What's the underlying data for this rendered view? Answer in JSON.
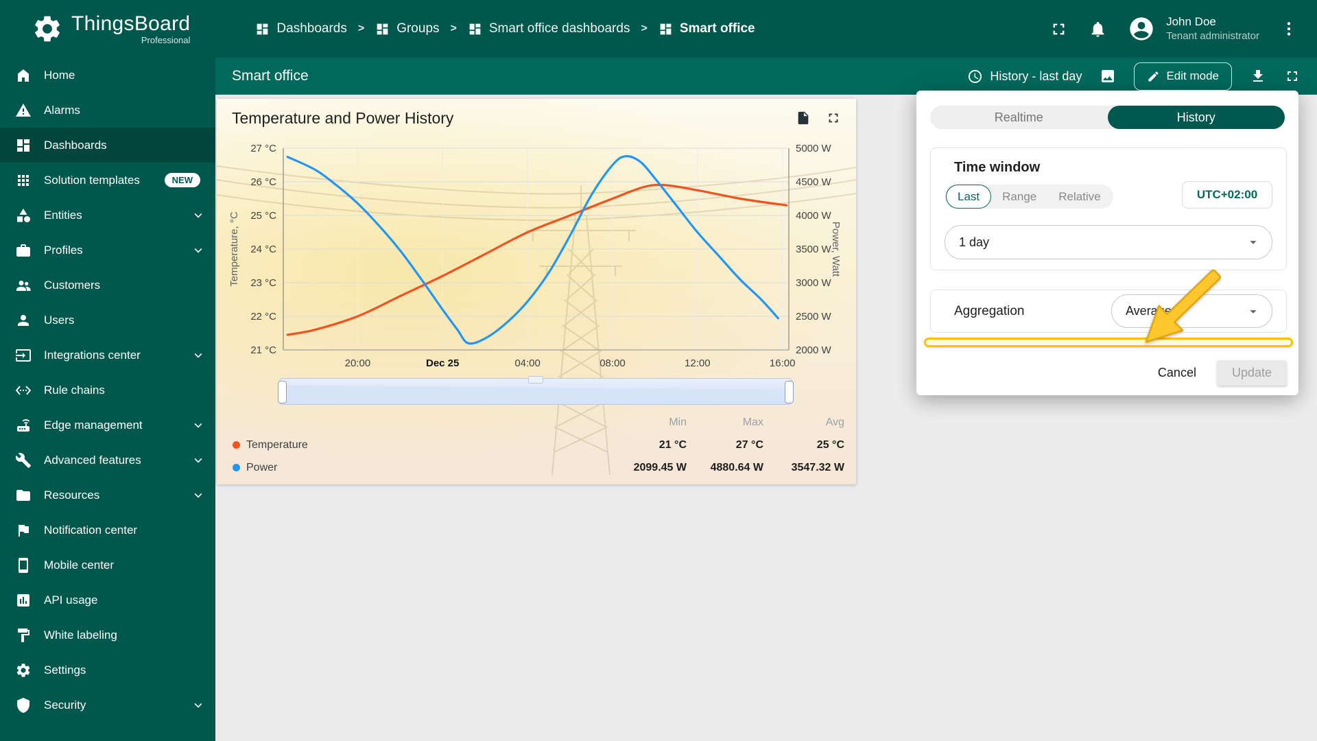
{
  "header": {
    "logo_title": "ThingsBoard",
    "logo_subtitle": "Professional",
    "separator": ">",
    "breadcrumbs": [
      {
        "label": "Dashboards"
      },
      {
        "label": "Groups"
      },
      {
        "label": "Smart office dashboards"
      },
      {
        "label": "Smart office"
      }
    ],
    "user": {
      "name": "John Doe",
      "role": "Tenant administrator"
    }
  },
  "sidebar": {
    "items": [
      {
        "label": "Home",
        "icon": "home-icon"
      },
      {
        "label": "Alarms",
        "icon": "alarm-icon"
      },
      {
        "label": "Dashboards",
        "icon": "dashboards-icon",
        "active": true
      },
      {
        "label": "Solution templates",
        "icon": "apps-icon",
        "badge": "NEW"
      },
      {
        "label": "Entities",
        "icon": "entities-icon",
        "expandable": true
      },
      {
        "label": "Profiles",
        "icon": "profiles-icon",
        "expandable": true
      },
      {
        "label": "Customers",
        "icon": "customers-icon"
      },
      {
        "label": "Users",
        "icon": "users-icon"
      },
      {
        "label": "Integrations center",
        "icon": "integrations-icon",
        "expandable": true
      },
      {
        "label": "Rule chains",
        "icon": "rule-chains-icon"
      },
      {
        "label": "Edge management",
        "icon": "edge-icon",
        "expandable": true
      },
      {
        "label": "Advanced features",
        "icon": "advanced-icon",
        "expandable": true
      },
      {
        "label": "Resources",
        "icon": "resources-icon",
        "expandable": true
      },
      {
        "label": "Notification center",
        "icon": "notification-icon"
      },
      {
        "label": "Mobile center",
        "icon": "mobile-icon"
      },
      {
        "label": "API usage",
        "icon": "api-icon"
      },
      {
        "label": "White labeling",
        "icon": "white-labeling-icon"
      },
      {
        "label": "Settings",
        "icon": "settings-icon"
      },
      {
        "label": "Security",
        "icon": "security-icon",
        "expandable": true
      }
    ]
  },
  "toolbar": {
    "title": "Smart office",
    "history_label": "History - last day",
    "edit_mode_label": "Edit mode"
  },
  "widget": {
    "title": "Temperature and Power History"
  },
  "chart_data": {
    "type": "line",
    "title": "Temperature and Power History",
    "x_ticks": [
      "20:00",
      "Dec 25",
      "04:00",
      "08:00",
      "12:00",
      "16:00"
    ],
    "x_tick_hours": [
      -4,
      0,
      4,
      8,
      12,
      16
    ],
    "x_range_hours": [
      -7.5,
      16.3
    ],
    "left_axis": {
      "label": "Temperature, °C",
      "range": [
        21,
        27
      ],
      "ticks": [
        "21 °C",
        "22 °C",
        "23 °C",
        "24 °C",
        "25 °C",
        "26 °C",
        "27 °C"
      ]
    },
    "right_axis": {
      "label": "Power, Watt",
      "range": [
        2000,
        5000
      ],
      "ticks": [
        "2000 W",
        "2500 W",
        "3000 W",
        "3500 W",
        "4000 W",
        "4500 W",
        "5000 W"
      ]
    },
    "grid": true,
    "legend_position": "bottom-left",
    "summary_headers": [
      "Min",
      "Max",
      "Avg"
    ],
    "series": [
      {
        "name": "Temperature",
        "axis": "left",
        "color": "#F4511E",
        "min": "21 °C",
        "max": "27 °C",
        "avg": "25 °C",
        "points": [
          [
            -7.3,
            21.45
          ],
          [
            -6,
            21.6
          ],
          [
            -4,
            22.0
          ],
          [
            -2,
            22.6
          ],
          [
            0,
            23.2
          ],
          [
            2,
            23.85
          ],
          [
            4,
            24.5
          ],
          [
            6,
            25.0
          ],
          [
            8,
            25.5
          ],
          [
            9.5,
            25.85
          ],
          [
            10.5,
            25.9
          ],
          [
            12,
            25.75
          ],
          [
            14,
            25.5
          ],
          [
            16.2,
            25.3
          ]
        ]
      },
      {
        "name": "Power",
        "axis": "right",
        "color": "#2196F3",
        "min": "2099.45 W",
        "max": "4880.64 W",
        "avg": "3547.32 W",
        "points": [
          [
            -7.3,
            4870
          ],
          [
            -6,
            4680
          ],
          [
            -5,
            4450
          ],
          [
            -4,
            4180
          ],
          [
            -3,
            3850
          ],
          [
            -2,
            3480
          ],
          [
            -1,
            3050
          ],
          [
            0,
            2600
          ],
          [
            0.7,
            2300
          ],
          [
            1.2,
            2100
          ],
          [
            2,
            2170
          ],
          [
            3,
            2400
          ],
          [
            4,
            2720
          ],
          [
            5,
            3150
          ],
          [
            6,
            3700
          ],
          [
            7,
            4300
          ],
          [
            8,
            4750
          ],
          [
            8.6,
            4880
          ],
          [
            9.3,
            4800
          ],
          [
            10,
            4550
          ],
          [
            11,
            4150
          ],
          [
            12,
            3750
          ],
          [
            13,
            3400
          ],
          [
            14,
            3050
          ],
          [
            15,
            2750
          ],
          [
            15.8,
            2470
          ]
        ]
      }
    ]
  },
  "panel": {
    "tabs": [
      {
        "label": "Realtime",
        "active": false
      },
      {
        "label": "History",
        "active": true
      }
    ],
    "time_window": {
      "heading": "Time window",
      "modes": [
        "Last",
        "Range",
        "Relative"
      ],
      "selected_mode": "Last",
      "timezone": "UTC+02:00",
      "interval": "1 day"
    },
    "aggregation": {
      "label": "Aggregation",
      "value": "Average"
    },
    "cancel_label": "Cancel",
    "update_label": "Update"
  },
  "colors": {
    "accent": "#00695C",
    "header": "#00574C",
    "highlight": "#FFC107",
    "temperature_series": "#F4511E",
    "power_series": "#2196F3"
  }
}
